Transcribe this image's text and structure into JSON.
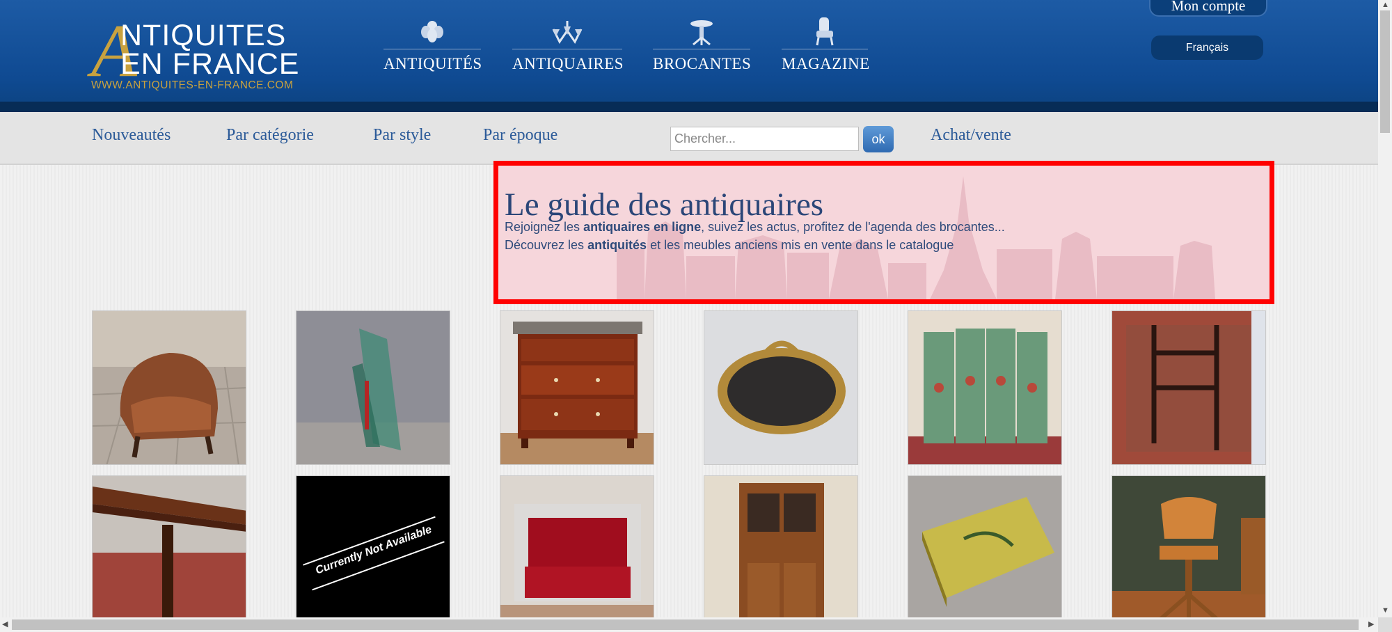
{
  "logo": {
    "line1": "NTIQUITES",
    "line2": "EN FRANCE",
    "big_letter": "A",
    "url": "WWW.ANTIQUITES-EN-FRANCE.COM"
  },
  "topnav": [
    {
      "label": "ANTIQUITÉS",
      "icon": "cherub-icon"
    },
    {
      "label": "ANTIQUAIRES",
      "icon": "chandelier-icon"
    },
    {
      "label": "BROCANTES",
      "icon": "pedestal-table-icon"
    },
    {
      "label": "MAGAZINE",
      "icon": "armchair-icon"
    }
  ],
  "account": {
    "label": "Mon compte"
  },
  "language": {
    "label": "Français"
  },
  "subnav": {
    "items": [
      "Nouveautés",
      "Par catégorie",
      "Par style",
      "Par époque"
    ],
    "search_placeholder": "Chercher...",
    "search_button": "ok",
    "achat_vente": "Achat/vente"
  },
  "guide": {
    "title": "Le guide des antiquaires",
    "line1_pre": "Rejoignez les ",
    "line1_bold": "antiquaires en ligne",
    "line1_post": ", suivez les actus, profitez de l'agenda des brocantes...",
    "line2_pre": "Découvrez les ",
    "line2_bold": "antiquités",
    "line2_post": " et les meubles anciens mis en vente dans le catalogue"
  },
  "products": [
    {
      "name": "leather-club-armchair"
    },
    {
      "name": "glass-sculpture"
    },
    {
      "name": "mahogany-chest-of-drawers"
    },
    {
      "name": "gilded-oval-mirror"
    },
    {
      "name": "painted-folding-screen"
    },
    {
      "name": "wooden-stand-on-rug"
    },
    {
      "name": "wooden-table"
    },
    {
      "name": "not-available",
      "overlay_text": "Currently Not Available"
    },
    {
      "name": "red-velvet-sofa"
    },
    {
      "name": "wooden-buffet"
    },
    {
      "name": "lacquered-coffee-table"
    },
    {
      "name": "wooden-office-chair"
    }
  ],
  "colors": {
    "header_blue": "#0f4a92",
    "gold": "#c9a23f",
    "link_blue": "#2b5a98",
    "highlight_red": "#ff0000"
  }
}
